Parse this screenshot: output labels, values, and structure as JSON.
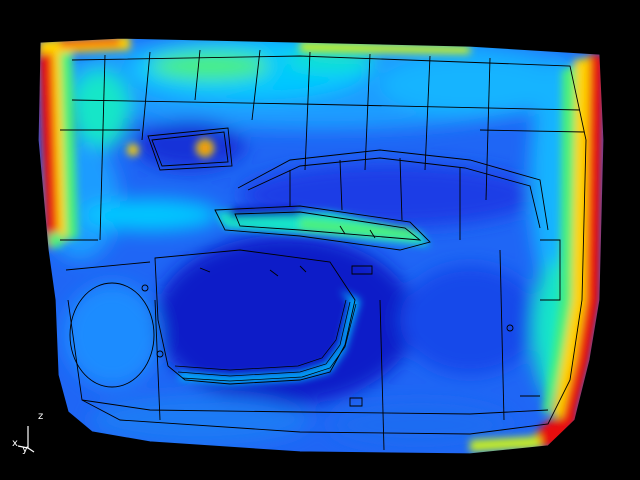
{
  "colors": {
    "background": "#000000",
    "contour_scale": [
      "#0a12b8",
      "#1a3fe0",
      "#1f7fff",
      "#00c8ff",
      "#19e6c8",
      "#4cf07a",
      "#c8f020",
      "#ffd200",
      "#ff6a00",
      "#e81010"
    ],
    "mesh_lines": "#000000",
    "triad": "#ffffff"
  },
  "triad": {
    "x_label": "x",
    "y_label": "y",
    "z_label": "z"
  },
  "model": {
    "part": "door-trim-panel",
    "result": "stress-contour"
  }
}
